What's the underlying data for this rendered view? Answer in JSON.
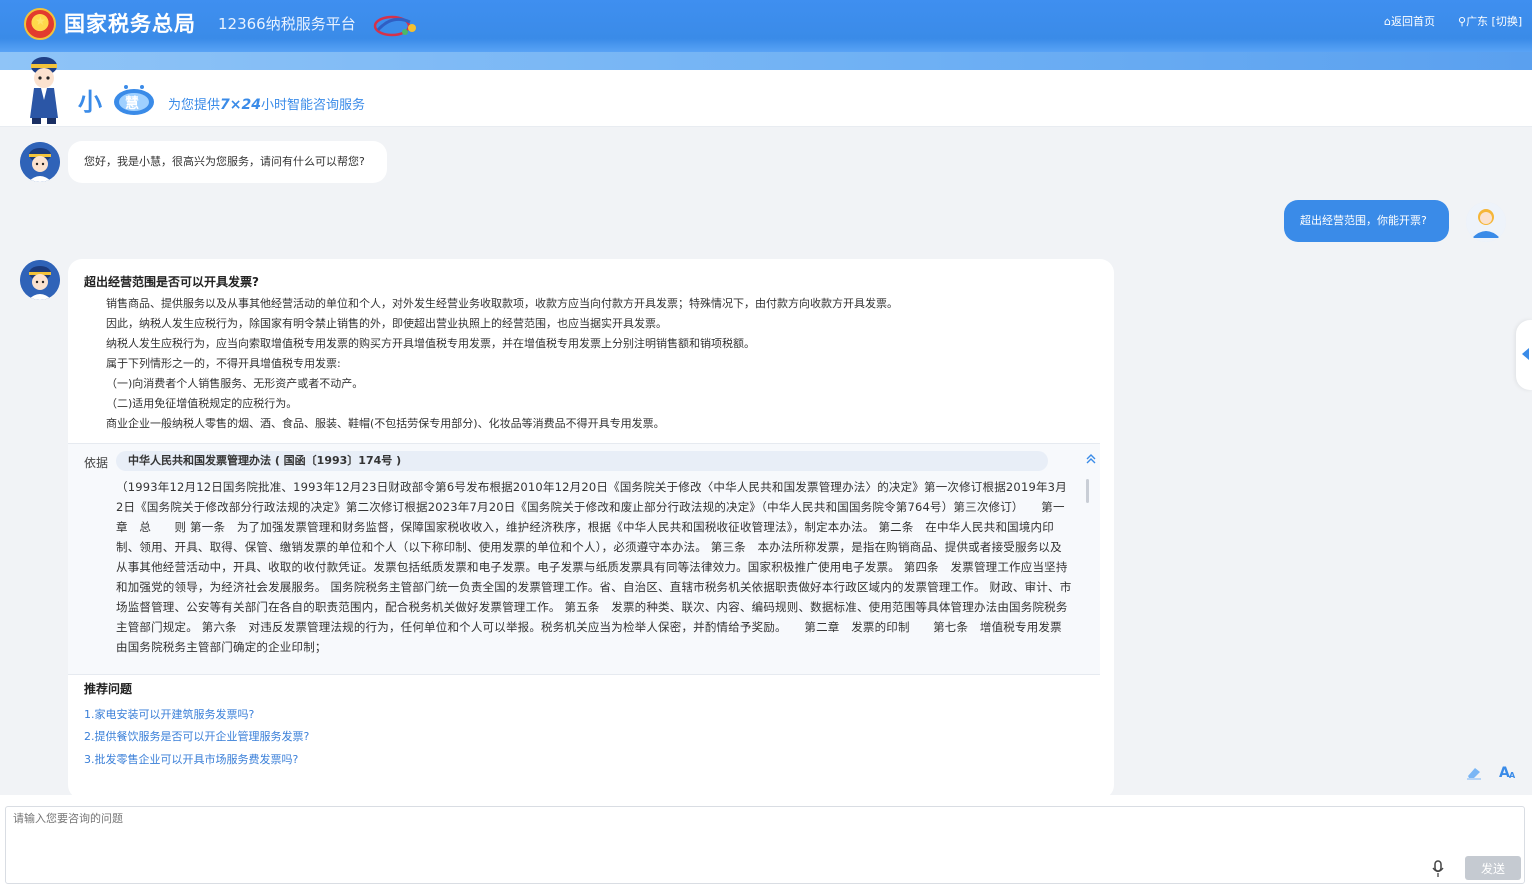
{
  "header": {
    "title": "国家税务总局",
    "subtitle": "12366纳税服务平台",
    "nav_home": "返回首页",
    "nav_region": "广东 [切换]"
  },
  "banner": {
    "logo_text": "小慧",
    "slogan_prefix": "为您提供",
    "slogan_hours": "7×24",
    "slogan_suffix": "小时智能咨询服务"
  },
  "messages": {
    "greeting": "您好，我是小慧，很高兴为您服务，请问有什么可以帮您?",
    "user_question": "超出经营范围，你能开票?",
    "answer": {
      "title": "超出经营范围是否可以开具发票?",
      "lines": [
        "销售商品、提供服务以及从事其他经营活动的单位和个人，对外发生经营业务收取款项，收款方应当向付款方开具发票；特殊情况下，由付款方向收款方开具发票。",
        "因此，纳税人发生应税行为，除国家有明令禁止销售的外，即使超出营业执照上的经营范围，也应当据实开具发票。",
        "纳税人发生应税行为，应当向索取增值税专用发票的购买方开具增值税专用发票，并在增值税专用发票上分别注明销售额和销项税额。",
        "属于下列情形之一的，不得开具增值税专用发票:",
        "（一)向消费者个人销售服务、无形资产或者不动产。",
        "（二)适用免征增值税规定的应税行为。",
        "商业企业一般纳税人零售的烟、酒、食品、服装、鞋帽(不包括劳保专用部分)、化妆品等消费品不得开具专用发票。"
      ],
      "basis_label": "依据",
      "basis_title": "中华人民共和国发票管理办法 ( 国函〔1993〕174号 )",
      "basis_text": "（1993年12月12日国务院批准、1993年12月23日财政部令第6号发布根据2010年12月20日《国务院关于修改〈中华人民共和国发票管理办法〉的决定》第一次修订根据2019年3月2日《国务院关于修改部分行政法规的决定》第二次修订根据2023年7月20日《国务院关于修改和废止部分行政法规的决定》（中华人民共和国国务院令第764号）第三次修订）　　第一章　总　　则 第一条　为了加强发票管理和财务监督，保障国家税收收入，维护经济秩序，根据《中华人民共和国税收征收管理法》，制定本办法。 第二条　在中华人民共和国境内印制、领用、开具、取得、保管、缴销发票的单位和个人（以下称印制、使用发票的单位和个人），必须遵守本办法。 第三条　本办法所称发票，是指在购销商品、提供或者接受服务以及从事其他经营活动中，开具、收取的收付款凭证。发票包括纸质发票和电子发票。电子发票与纸质发票具有同等法律效力。国家积极推广使用电子发票。 第四条　发票管理工作应当坚持和加强党的领导，为经济社会发展服务。 国务院税务主管部门统一负责全国的发票管理工作。省、自治区、直辖市税务机关依据职责做好本行政区域内的发票管理工作。 财政、审计、市场监督管理、公安等有关部门在各自的职责范围内，配合税务机关做好发票管理工作。 第五条　发票的种类、联次、内容、编码规则、数据标准、使用范围等具体管理办法由国务院税务主管部门规定。 第六条　对违反发票管理法规的行为，任何单位和个人可以举报。税务机关应当为检举人保密，并酌情给予奖励。　　第二章　发票的印制　　第七条　增值税专用发票由国务院税务主管部门确定的企业印制；"
    },
    "recommend": {
      "title": "推荐问题",
      "items": [
        "1.家电安装可以开建筑服务发票吗?",
        "2.提供餐饮服务是否可以开企业管理服务发票?",
        "3.批发零售企业可以开具市场服务费发票吗?"
      ]
    }
  },
  "input": {
    "placeholder": "请输入您要咨询的问题",
    "send_label": "发送"
  },
  "colors": {
    "brand_blue": "#3a8be8",
    "link_blue": "#3a7fd8",
    "send_disabled": "#c5cad1"
  },
  "icons": [
    "home-icon",
    "location-icon",
    "mascot-icon",
    "bot-avatar-icon",
    "user-avatar-icon",
    "collapse-icon",
    "side-panel-toggle-icon",
    "eraser-icon",
    "font-size-icon",
    "microphone-icon"
  ]
}
